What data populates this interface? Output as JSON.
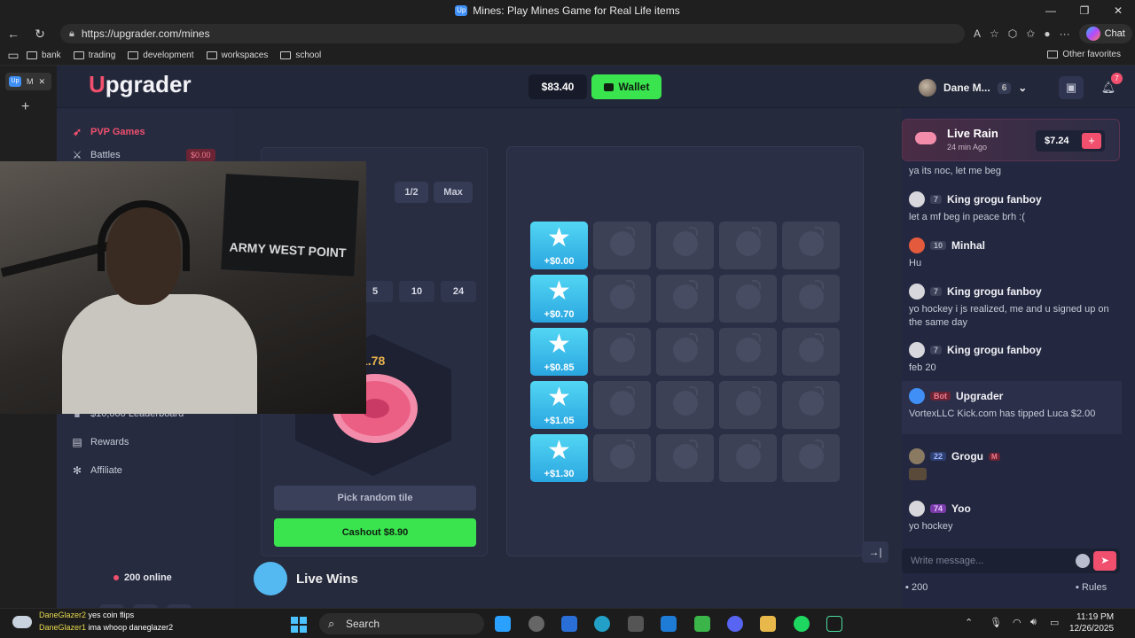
{
  "window": {
    "title": "Mines: Play Mines Game for Real Life items",
    "min": "—",
    "max": "❐",
    "close": "✕"
  },
  "browser": {
    "url": "https://upgrader.com/mines",
    "chat_label": "Chat",
    "bookmarks": [
      "bank",
      "trading",
      "development",
      "workspaces",
      "school"
    ],
    "other_favorites": "Other favorites",
    "tab_label": "M"
  },
  "site": {
    "brand": "pgrader",
    "brand_initial": "U",
    "balance": "$83.40",
    "wallet_label": "Wallet",
    "user_name": "Dane M...",
    "user_level": "6",
    "notification_count": "7"
  },
  "sidebar": {
    "items": [
      {
        "label": "PVP Games",
        "icon": "rocket-icon"
      },
      {
        "label": "Battles",
        "icon": "swords-icon",
        "amount": "$0.00"
      },
      {
        "label": "$10,000 Leaderboard",
        "icon": "trophy-icon"
      },
      {
        "label": "Rewards",
        "icon": "gift-icon"
      },
      {
        "label": "Affiliate",
        "icon": "network-icon"
      }
    ],
    "online": "200 online"
  },
  "controls": {
    "half_label": "1/2",
    "max_label": "Max",
    "mine_options": [
      "5",
      "10",
      "24"
    ],
    "multiplier": "1.78",
    "pick_random": "Pick random tile",
    "cashout": "Cashout $8.90"
  },
  "board": {
    "star_values": [
      "+$0.00",
      "+$0.70",
      "+$0.85",
      "+$1.05",
      "+$1.30"
    ]
  },
  "live_wins": "Live Wins",
  "chat": {
    "rain_title": "Live Rain",
    "rain_ago": "24 min Ago",
    "rain_amount": "$7.24",
    "messages": [
      {
        "user": "",
        "level": "",
        "text": "ya its noc, let me beg"
      },
      {
        "user": "King grogu fanboy",
        "level": "7",
        "text": "let a mf beg in peace brh :("
      },
      {
        "user": "Minhal",
        "level": "10",
        "text": "Hu"
      },
      {
        "user": "King grogu fanboy",
        "level": "7",
        "text": "yo hockey i js realized, me and u signed up on the same day"
      },
      {
        "user": "King grogu fanboy",
        "level": "7",
        "text": "feb 20"
      },
      {
        "user": "Upgrader",
        "level": "Bot",
        "text": "VortexLLC Kick.com has tipped Luca $2.00"
      },
      {
        "user": "Grogu",
        "level": "22",
        "badge": "M",
        "text": ""
      },
      {
        "user": "Yoo",
        "level": "74",
        "text": "yo hockey"
      }
    ],
    "input_placeholder": "Write message...",
    "online_count": "200",
    "rules": "Rules"
  },
  "webcam": {
    "flag_text": "ARMY WEST POINT"
  },
  "stream_overlay": [
    {
      "user": "DaneGlazer2",
      "text": "yes coin flips"
    },
    {
      "user": "DaneGlazer1",
      "text": "ima whoop daneglazer2"
    }
  ],
  "taskbar": {
    "search": "Search",
    "time": "11:19 PM",
    "date": "12/26/2025"
  }
}
